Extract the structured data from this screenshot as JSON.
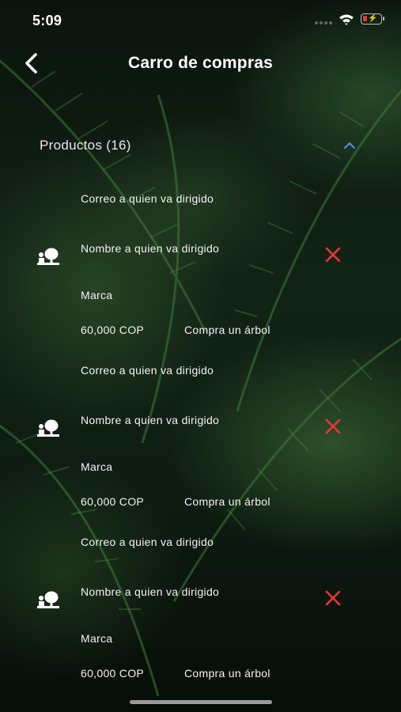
{
  "status_bar": {
    "time": "5:09"
  },
  "header": {
    "title": "Carro de compras",
    "back_icon": "chevron-left-icon"
  },
  "section": {
    "label": "Productos (16)",
    "toggle_icon": "chevron-up-icon",
    "accent": "#4a90e2"
  },
  "products": [
    {
      "email_label": "Correo a quien va dirigido",
      "name_label": "Nombre a quien va dirigido",
      "brand_label": "Marca",
      "price": "60,000 COP",
      "description": "Compra un árbol",
      "icon": "tree-gift-icon",
      "remove_icon": "close-icon"
    },
    {
      "email_label": "Correo a quien va dirigido",
      "name_label": "Nombre a quien va dirigido",
      "brand_label": "Marca",
      "price": "60,000 COP",
      "description": "Compra un árbol",
      "icon": "tree-gift-icon",
      "remove_icon": "close-icon"
    },
    {
      "email_label": "Correo a quien va dirigido",
      "name_label": "Nombre a quien va dirigido",
      "brand_label": "Marca",
      "price": "60,000 COP",
      "description": "Compra un árbol",
      "icon": "tree-gift-icon",
      "remove_icon": "close-icon"
    }
  ],
  "colors": {
    "remove": "#e53935",
    "battery_low": "#e53935"
  }
}
